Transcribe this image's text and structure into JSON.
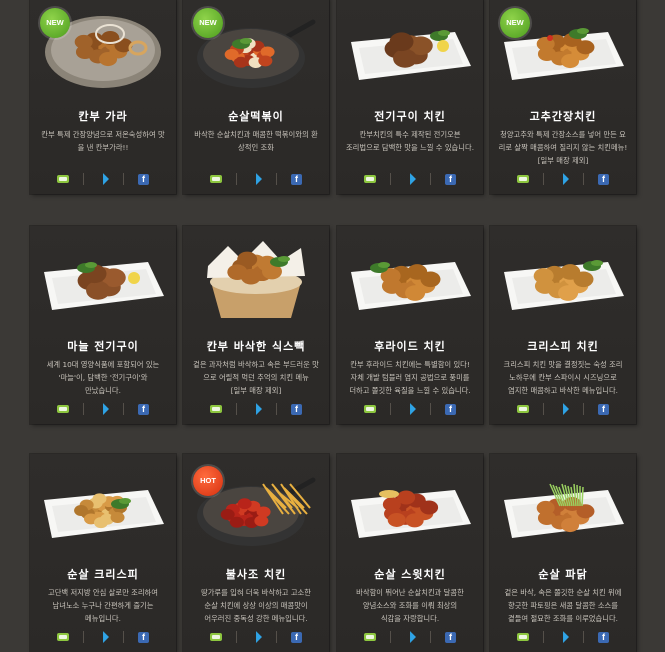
{
  "colors": {
    "background": "#3b3936",
    "card": "#2d2b29",
    "title": "#ffffff",
    "desc": "#c9c4bc",
    "new_badge": "#5aab24",
    "hot_badge": "#e2401a"
  },
  "share_icons": [
    "blog-icon",
    "twitter-icon",
    "facebook-icon"
  ],
  "menu": [
    {
      "title": "칸부 가라",
      "badge": "NEW",
      "desc": [
        "칸부 특제 간장양념으로 저온숙성하여 맛",
        "을 낸 칸부가라!!"
      ],
      "photo": "karaage"
    },
    {
      "title": "순살떡볶이",
      "badge": "NEW",
      "desc": [
        "바삭한 순살치킨과 매콤한 떡볶이와의 환",
        "상적인 조화"
      ],
      "photo": "tteokbokki"
    },
    {
      "title": "전기구이 치킨",
      "badge": "",
      "desc": [
        "칸부치킨의 특수 제작된 전기오븐",
        "조리법으로 담백한 맛을 느낄 수 있습니다."
      ],
      "photo": "roast"
    },
    {
      "title": "고추간장치킨",
      "badge": "NEW",
      "desc": [
        "청양고추와 특제 간장소스를 넣어 만든 요",
        "리로 살짝 매콤하여 질리지 않는 치킨메뉴!",
        "[일부 매장 제외]"
      ],
      "photo": "soy"
    },
    {
      "title": "마늘 전기구이",
      "badge": "",
      "desc": [
        "세계 10대 영양식품에 포함되어 있는",
        "'마늘'이, 담백한 '전기구이'와",
        "만났습니다."
      ],
      "photo": "garlic"
    },
    {
      "title": "칸부 바삭한 식스빽",
      "badge": "",
      "desc": [
        "겉은 과자처럼 바삭하고 속은 부드러운 맛",
        "으로 어릴적 먹던 추억의 치킨 메뉴",
        "[일부 매장 제외]"
      ],
      "photo": "basket"
    },
    {
      "title": "후라이드 치킨",
      "badge": "",
      "desc": [
        "칸부 후라이드 치킨에는 특별함이 있다!",
        "자체 개발 텀블러 염지 공법으로 풍미를",
        "더하고 쫄깃한 육질을 느낄 수 있습니다."
      ],
      "photo": "fried"
    },
    {
      "title": "크리스피 치킨",
      "badge": "",
      "desc": [
        "크리스피 치킨 맛을 결정짓는 숙성 조리",
        "노하우에 칸부 스파이시 시즈닝으로",
        "염지한 매콤하고 바삭한 메뉴입니다."
      ],
      "photo": "crispy"
    },
    {
      "title": "순살 크리스피",
      "badge": "",
      "desc": [
        "고단백 저지방 안심 살로만 조리하여",
        "남녀노소 누구나 간편하게 즐기는",
        "메뉴입니다."
      ],
      "photo": "boneless"
    },
    {
      "title": "불사조 치킨",
      "badge": "HOT",
      "desc": [
        "땅가루를 입혀 더욱 바삭하고 고소한",
        "순살 치킨에 상상 이상의 매콤맛이",
        "어우러진 중독성 강한 메뉴입니다."
      ],
      "photo": "buldak"
    },
    {
      "title": "순살 스윗치킨",
      "badge": "",
      "desc": [
        "바삭함이 뛰어난 순살치킨과 달콤한",
        "양념소스와 조화를 이뤄 최상의",
        "식감을 자랑합니다."
      ],
      "photo": "sweet"
    },
    {
      "title": "순살 파닭",
      "badge": "",
      "desc": [
        "겉은 바삭, 속은 쫄깃한 순살 치킨 위에",
        "향긋한 파토핑은 새콤 달콤한 소스를",
        "곁들여 절묘한 조화를 이루었습니다."
      ],
      "photo": "padak"
    }
  ]
}
